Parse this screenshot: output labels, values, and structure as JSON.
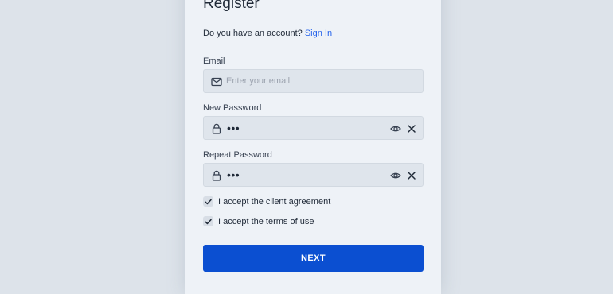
{
  "card": {
    "title": "Register",
    "account_prompt": "Do you have an account?",
    "sign_in_link": "Sign In"
  },
  "email": {
    "label": "Email",
    "placeholder": "Enter your email",
    "value": "",
    "icon": "mail-icon"
  },
  "new_password": {
    "label": "New Password",
    "masked_value": "•••",
    "icons": [
      "lock-icon",
      "eye-icon",
      "close-icon"
    ]
  },
  "repeat_password": {
    "label": "Repeat Password",
    "masked_value": "•••",
    "icons": [
      "lock-icon",
      "eye-icon",
      "close-icon"
    ]
  },
  "agreements": [
    {
      "label": "I accept the client agreement",
      "checked": true
    },
    {
      "label": "I accept the terms of use",
      "checked": true
    }
  ],
  "next_button": {
    "label": "NEXT",
    "color": "#0b4fd1"
  },
  "colors": {
    "background": "#dde3ea",
    "card": "#eef2f7",
    "field": "#dfe5ec",
    "link": "#2563eb"
  }
}
